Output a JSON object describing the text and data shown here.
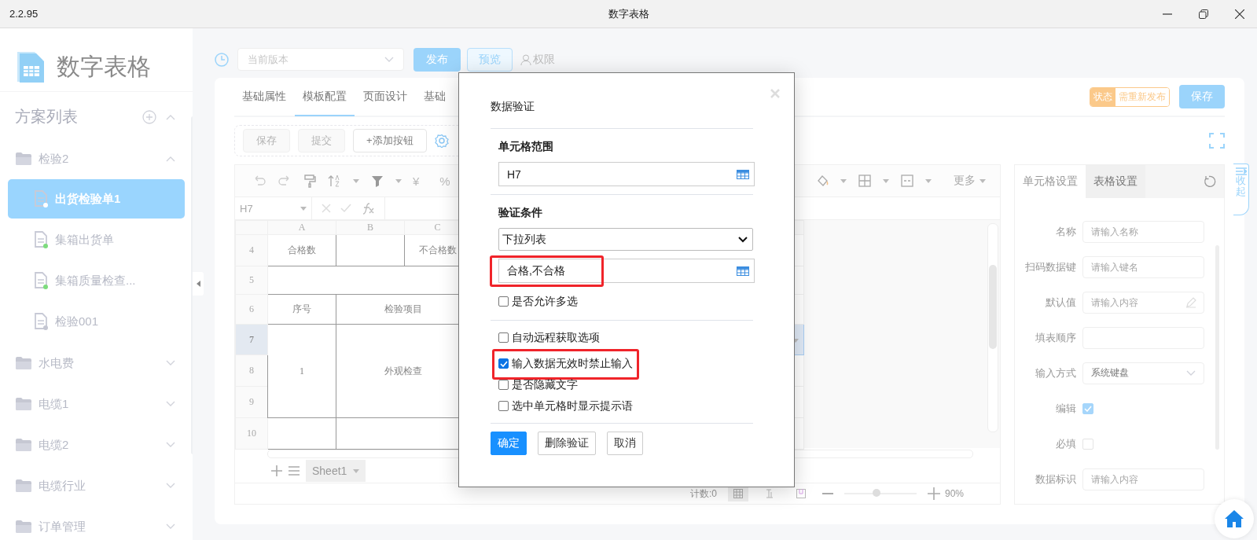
{
  "window": {
    "version": "2.2.95",
    "title": "数字表格"
  },
  "sidebar": {
    "app_name": "数字表格",
    "section_title": "方案列表",
    "folders": [
      {
        "name": "检验2",
        "expanded": true,
        "children": [
          {
            "name": "出货检验单1",
            "selected": true,
            "color": "#ffffff"
          },
          {
            "name": "集箱出货单",
            "selected": false,
            "color": "#7ddc7d"
          },
          {
            "name": "集箱质量检查...",
            "selected": false,
            "color": "#7ddc7d"
          },
          {
            "name": "检验001",
            "selected": false,
            "color": "#c4c6d2"
          }
        ]
      },
      {
        "name": "水电费",
        "expanded": false
      },
      {
        "name": "电缆1",
        "expanded": false
      },
      {
        "name": "电缆2",
        "expanded": false
      },
      {
        "name": "电缆行业",
        "expanded": false
      },
      {
        "name": "订单管理",
        "expanded": false
      }
    ]
  },
  "top_bar": {
    "version_placeholder": "当前版本",
    "publish": "发布",
    "preview": "预览",
    "permission": "权限"
  },
  "tabs": [
    {
      "label": "基础属性",
      "selected": false
    },
    {
      "label": "模板配置",
      "selected": true
    },
    {
      "label": "页面设计",
      "selected": false
    },
    {
      "label": "基础",
      "selected": false
    }
  ],
  "status_badge": {
    "label": "状态",
    "value": "需重新发布"
  },
  "save_button": "保存",
  "action_buttons": [
    {
      "label": "保存",
      "disabled": true
    },
    {
      "label": "提交",
      "disabled": true
    },
    {
      "label": "+添加按钮",
      "disabled": false
    }
  ],
  "sheet": {
    "currency": "¥",
    "percent": "%",
    "more": "更多",
    "name_box": "H7",
    "columns": [
      "A",
      "B",
      "C"
    ],
    "rows": [
      {
        "label": "4",
        "selected": false
      },
      {
        "label": "5",
        "selected": false
      },
      {
        "label": "6",
        "selected": false
      },
      {
        "label": "7",
        "selected": true
      },
      {
        "label": "8",
        "selected": false
      },
      {
        "label": "9",
        "selected": false
      },
      {
        "label": "10",
        "selected": false
      }
    ],
    "cells": {
      "A4": "合格数",
      "C4": "不合格数",
      "A6": "序号",
      "B6": "检验项目",
      "A7": "1",
      "B7": "外观检查"
    },
    "sheet_tabs": [
      {
        "name": "Sheet1",
        "selected": true
      }
    ],
    "count": "计数:0",
    "zoom": "90%",
    "zoom_level": {
      "level": 0.45
    }
  },
  "panel": {
    "tabs": [
      {
        "label": "单元格设置",
        "selected": true
      },
      {
        "label": "表格设置",
        "selected": false
      }
    ],
    "fields": [
      {
        "kind": "text",
        "label": "名称",
        "placeholder": "请输入名称"
      },
      {
        "kind": "text",
        "label": "扫码数据键",
        "placeholder": "请输入键名"
      },
      {
        "kind": "edit",
        "label": "默认值",
        "placeholder": "请输入内容"
      },
      {
        "kind": "text",
        "label": "填表顺序"
      },
      {
        "kind": "select",
        "label": "输入方式",
        "value": "系统键盘"
      },
      {
        "kind": "checkbox",
        "label": "编辑",
        "checked": true
      },
      {
        "kind": "checkbox",
        "label": "必填",
        "checked": false
      },
      {
        "kind": "text",
        "label": "数据标识",
        "placeholder": "请输入内容"
      }
    ],
    "collapse": "收起"
  },
  "dialog": {
    "title": "数据验证",
    "range": {
      "heading": "单元格范围",
      "value": "H7"
    },
    "condition": {
      "heading": "验证条件",
      "type": "下拉列表",
      "source": "合格,不合格",
      "source_highlighted": true
    },
    "options": [
      {
        "label": "是否允许多选",
        "checked": false,
        "highlighted": false
      }
    ],
    "more_options": [
      {
        "label": "自动远程获取选项",
        "checked": false,
        "highlighted": false
      },
      {
        "label": "输入数据无效时禁止输入",
        "checked": true,
        "highlighted": true
      },
      {
        "label": "是否隐藏文字",
        "checked": false,
        "highlighted": false
      },
      {
        "label": "选中单元格时显示提示语",
        "checked": false,
        "highlighted": false
      }
    ],
    "buttons": [
      {
        "label": "确定",
        "kind": "primary"
      },
      {
        "label": "删除验证",
        "kind": "default"
      },
      {
        "label": "取消",
        "kind": "default"
      }
    ]
  }
}
